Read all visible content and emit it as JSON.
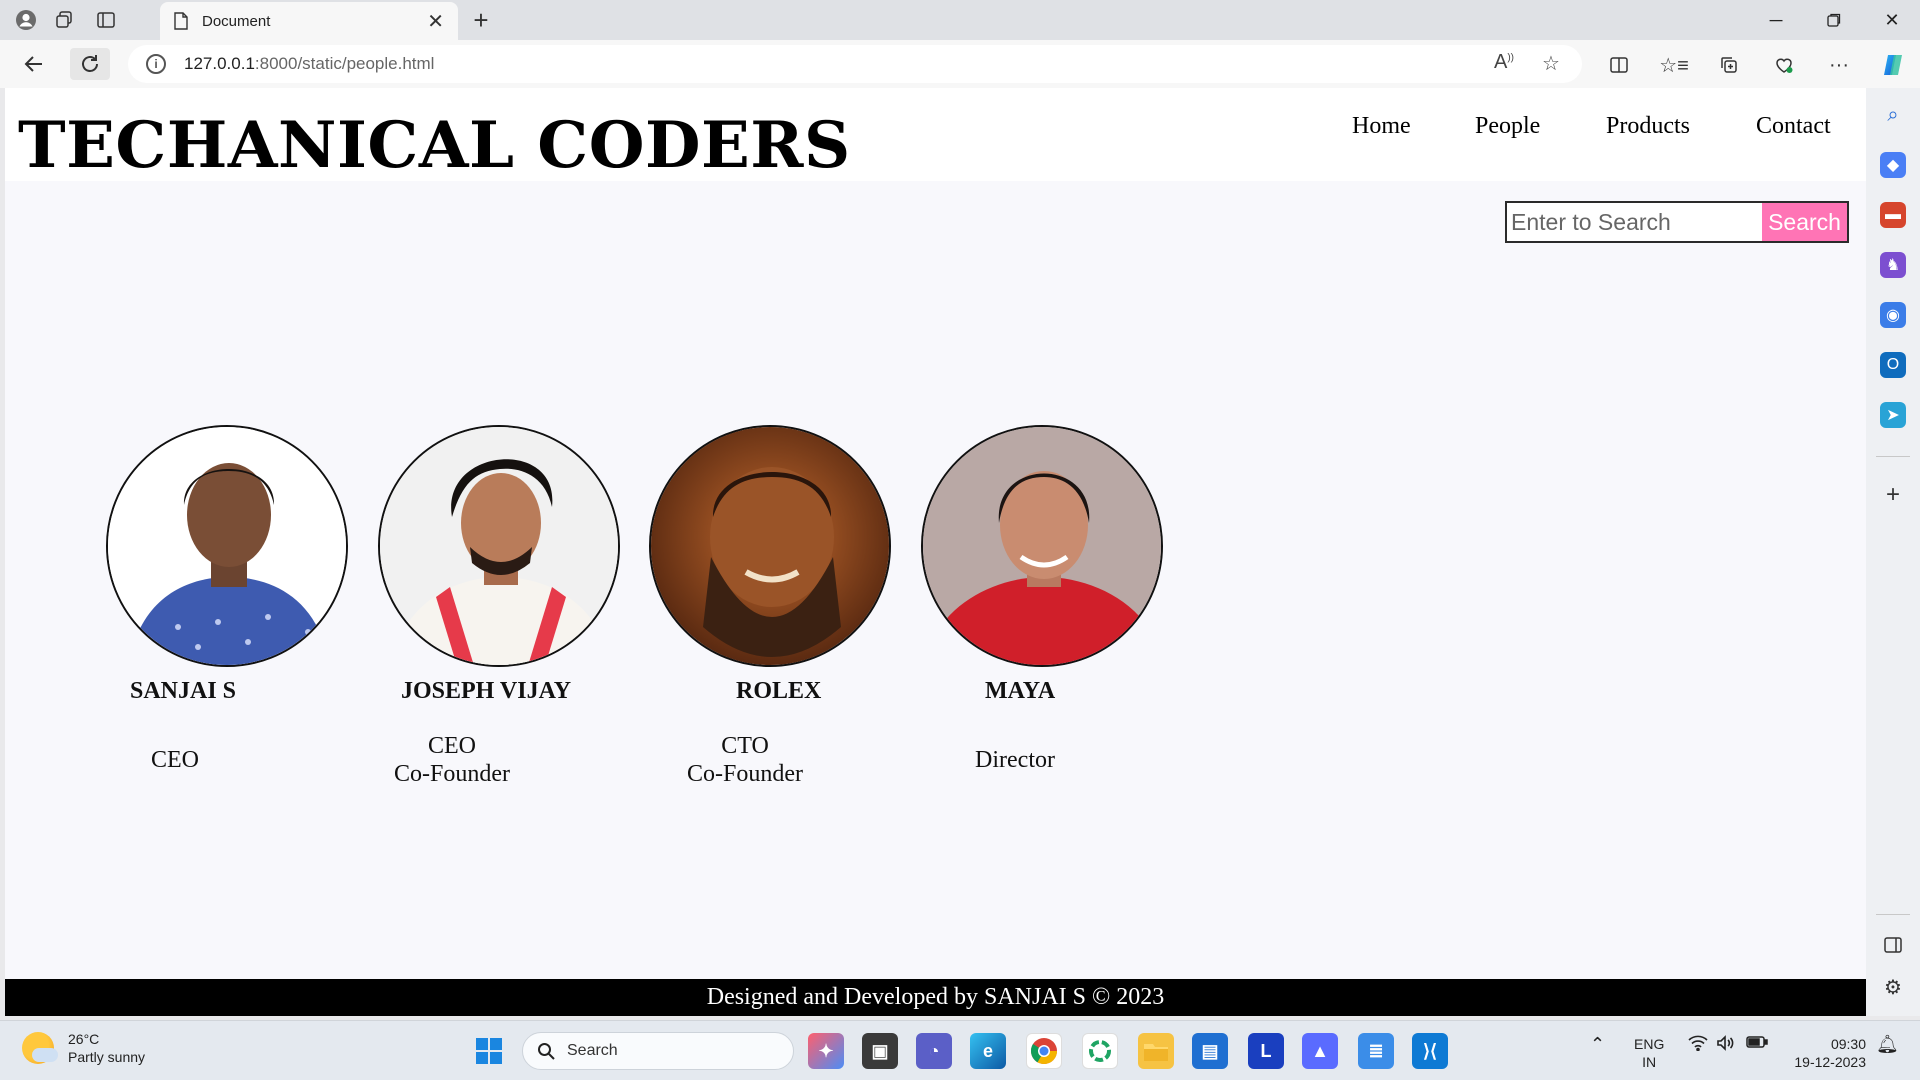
{
  "browser": {
    "tab_title": "Document",
    "url_host": "127.0.0.1",
    "url_path": ":8000/static/people.html"
  },
  "site": {
    "brand": "TECHANICAL CODERS",
    "nav": [
      "Home",
      "People",
      "Products",
      "Contact"
    ],
    "search": {
      "placeholder": "Enter to Search",
      "button": "Search"
    },
    "people": [
      {
        "name": "SANJAI S",
        "role_lines": [
          "CEO"
        ]
      },
      {
        "name": "JOSEPH VIJAY",
        "role_lines": [
          "CEO",
          "Co-Founder"
        ]
      },
      {
        "name": "ROLEX",
        "role_lines": [
          "CTO",
          "Co-Founder"
        ]
      },
      {
        "name": "MAYA",
        "role_lines": [
          "Director"
        ]
      }
    ],
    "footer": "Designed and Developed by SANJAI S © 2023"
  },
  "taskbar": {
    "weather_temp": "26°C",
    "weather_desc": "Partly sunny",
    "search_label": "Search",
    "lang_top": "ENG",
    "lang_bottom": "IN",
    "time": "09:30",
    "date": "19-12-2023"
  },
  "colors": {
    "search_button": "#ff74b5",
    "footer_bg": "#000000",
    "page_bg": "#f8f8fc"
  }
}
